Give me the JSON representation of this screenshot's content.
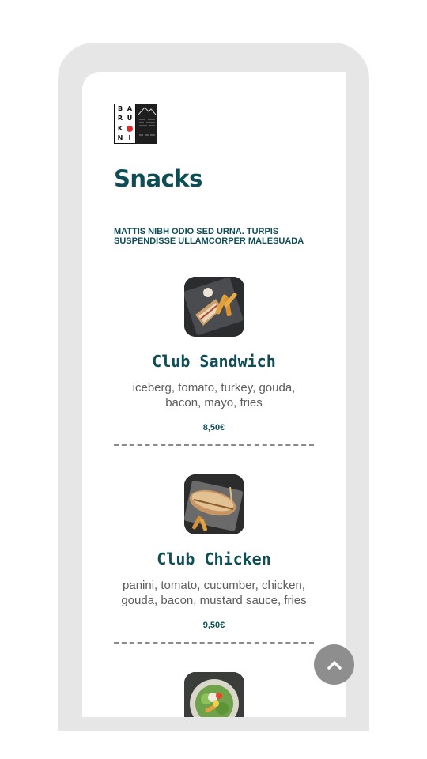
{
  "logo": {
    "letters": [
      "B",
      "A",
      "R",
      "U",
      "K",
      "",
      "N",
      "I"
    ],
    "alt_text": "BARUKONI"
  },
  "page": {
    "title": "Snacks",
    "subtitle": "MATTIS NIBH ODIO SED URNA. TURPIS SUSPENDISSE ULLAMCORPER MALESUADA"
  },
  "menu": [
    {
      "name": "Club Sandwich",
      "description": "iceberg, tomato, turkey, gouda, bacon, mayo, fries",
      "price": "8,50€"
    },
    {
      "name": "Club Chicken",
      "description": "panini, tomato, cucumber, chicken, gouda, bacon, mustard sauce, fries",
      "price": "9,50€"
    }
  ],
  "scroll_top": {
    "icon": "chevron-up-icon"
  },
  "colors": {
    "accent": "#0e4c56",
    "frame": "#e6e6e6",
    "logo_dot": "#e32a2a",
    "scroll_button": "#8e8e8e"
  }
}
